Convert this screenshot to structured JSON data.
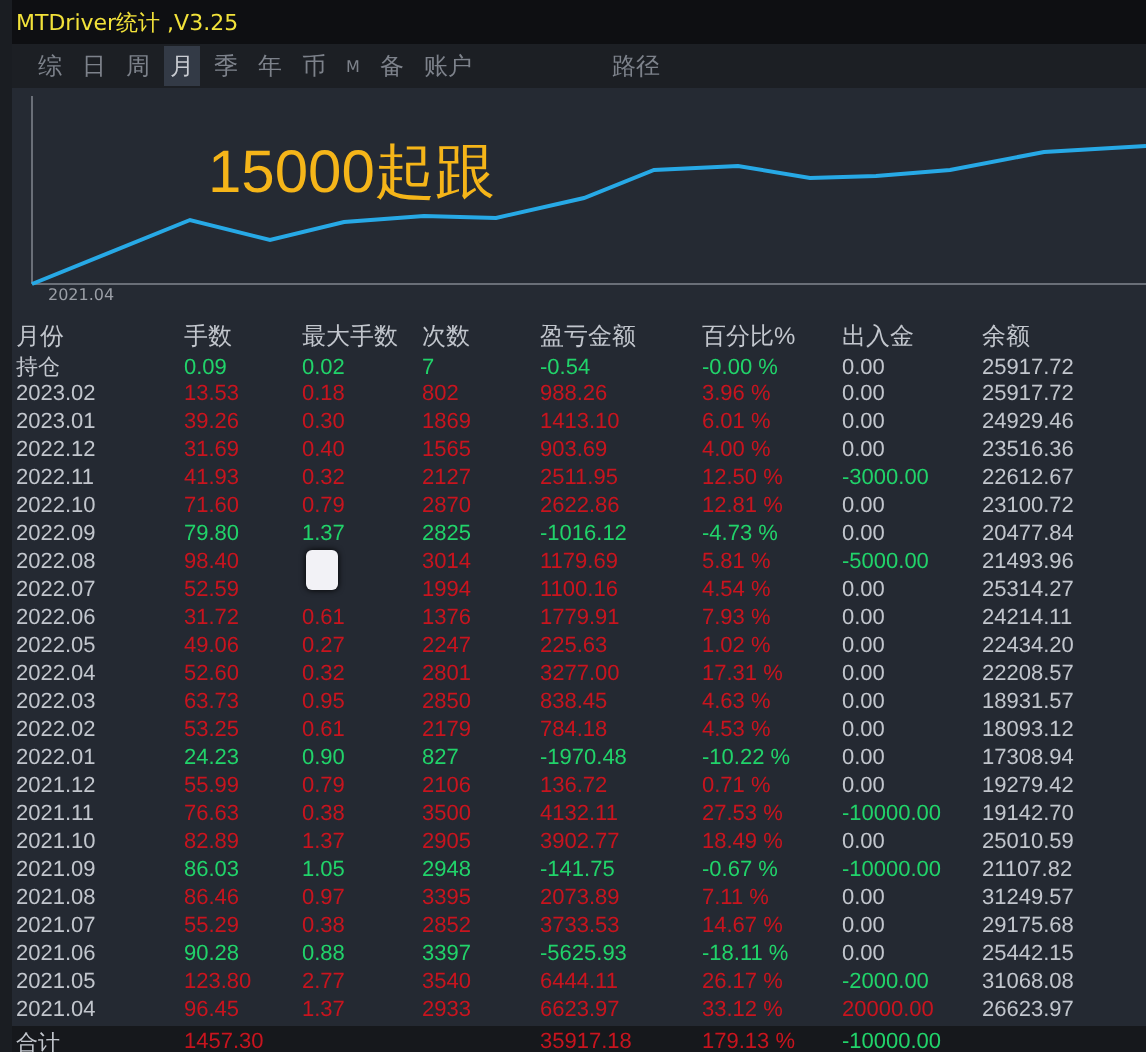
{
  "window": {
    "title": "MTDriver统计 ,V3.25"
  },
  "tabs": [
    {
      "label": "综",
      "selected": false,
      "kind": "tab"
    },
    {
      "label": "日",
      "selected": false,
      "kind": "tab"
    },
    {
      "label": "周",
      "selected": false,
      "kind": "tab"
    },
    {
      "label": "月",
      "selected": true,
      "kind": "tab"
    },
    {
      "label": "季",
      "selected": false,
      "kind": "tab"
    },
    {
      "label": "年",
      "selected": false,
      "kind": "tab"
    },
    {
      "label": "币",
      "selected": false,
      "kind": "tab"
    },
    {
      "label": "M",
      "selected": false,
      "kind": "small"
    },
    {
      "label": "备",
      "selected": false,
      "kind": "tab"
    },
    {
      "label": "账户",
      "selected": false,
      "kind": "tab"
    },
    {
      "label": "路径",
      "selected": false,
      "kind": "far"
    }
  ],
  "chart": {
    "annotation": "15000起跟",
    "x_label": "2021.04"
  },
  "table": {
    "columns": [
      "月份",
      "手数",
      "最大手数",
      "次数",
      "盈亏金额",
      "百分比%",
      "出入金",
      "余额"
    ],
    "rows": [
      {
        "month": "持仓",
        "lots": "0.09",
        "max_lots": "0.02",
        "trades": "7",
        "pnl": "-0.54",
        "pct": "-0.00 %",
        "flow": {
          "text": "0.00",
          "color": "#c2c6cd"
        },
        "balance": "25917.72",
        "color": "#21d36a"
      },
      {
        "month": "2023.02",
        "lots": "13.53",
        "max_lots": "0.18",
        "trades": "802",
        "pnl": "988.26",
        "pct": "3.96 %",
        "flow": {
          "text": "0.00",
          "color": "#c2c6cd"
        },
        "balance": "25917.72",
        "color": "#c8141e"
      },
      {
        "month": "2023.01",
        "lots": "39.26",
        "max_lots": "0.30",
        "trades": "1869",
        "pnl": "1413.10",
        "pct": "6.01 %",
        "flow": {
          "text": "0.00",
          "color": "#c2c6cd"
        },
        "balance": "24929.46",
        "color": "#c8141e"
      },
      {
        "month": "2022.12",
        "lots": "31.69",
        "max_lots": "0.40",
        "trades": "1565",
        "pnl": "903.69",
        "pct": "4.00 %",
        "flow": {
          "text": "0.00",
          "color": "#c2c6cd"
        },
        "balance": "23516.36",
        "color": "#c8141e"
      },
      {
        "month": "2022.11",
        "lots": "41.93",
        "max_lots": "0.32",
        "trades": "2127",
        "pnl": "2511.95",
        "pct": "12.50 %",
        "flow": {
          "text": "-3000.00",
          "color": "#21d36a"
        },
        "balance": "22612.67",
        "color": "#c8141e"
      },
      {
        "month": "2022.10",
        "lots": "71.60",
        "max_lots": "0.79",
        "trades": "2870",
        "pnl": "2622.86",
        "pct": "12.81 %",
        "flow": {
          "text": "0.00",
          "color": "#c2c6cd"
        },
        "balance": "23100.72",
        "color": "#c8141e"
      },
      {
        "month": "2022.09",
        "lots": "79.80",
        "max_lots": "1.37",
        "trades": "2825",
        "pnl": "-1016.12",
        "pct": "-4.73 %",
        "flow": {
          "text": "0.00",
          "color": "#c2c6cd"
        },
        "balance": "20477.84",
        "color": "#21d36a"
      },
      {
        "month": "2022.08",
        "lots": "98.40",
        "trades": "3014",
        "pnl": "1179.69",
        "pct": "5.81 %",
        "flow": {
          "text": "-5000.00",
          "color": "#21d36a"
        },
        "balance": "21493.96",
        "color": "#c8141e"
      },
      {
        "month": "2022.07",
        "lots": "52.59",
        "trades": "1994",
        "pnl": "1100.16",
        "pct": "4.54 %",
        "flow": {
          "text": "0.00",
          "color": "#c2c6cd"
        },
        "balance": "25314.27",
        "color": "#c8141e"
      },
      {
        "month": "2022.06",
        "lots": "31.72",
        "max_lots": "0.61",
        "trades": "1376",
        "pnl": "1779.91",
        "pct": "7.93 %",
        "flow": {
          "text": "0.00",
          "color": "#c2c6cd"
        },
        "balance": "24214.11",
        "color": "#c8141e"
      },
      {
        "month": "2022.05",
        "lots": "49.06",
        "max_lots": "0.27",
        "trades": "2247",
        "pnl": "225.63",
        "pct": "1.02 %",
        "flow": {
          "text": "0.00",
          "color": "#c2c6cd"
        },
        "balance": "22434.20",
        "color": "#c8141e"
      },
      {
        "month": "2022.04",
        "lots": "52.60",
        "max_lots": "0.32",
        "trades": "2801",
        "pnl": "3277.00",
        "pct": "17.31 %",
        "flow": {
          "text": "0.00",
          "color": "#c2c6cd"
        },
        "balance": "22208.57",
        "color": "#c8141e"
      },
      {
        "month": "2022.03",
        "lots": "63.73",
        "max_lots": "0.95",
        "trades": "2850",
        "pnl": "838.45",
        "pct": "4.63 %",
        "flow": {
          "text": "0.00",
          "color": "#c2c6cd"
        },
        "balance": "18931.57",
        "color": "#c8141e"
      },
      {
        "month": "2022.02",
        "lots": "53.25",
        "max_lots": "0.61",
        "trades": "2179",
        "pnl": "784.18",
        "pct": "4.53 %",
        "flow": {
          "text": "0.00",
          "color": "#c2c6cd"
        },
        "balance": "18093.12",
        "color": "#c8141e"
      },
      {
        "month": "2022.01",
        "lots": "24.23",
        "max_lots": "0.90",
        "trades": "827",
        "pnl": "-1970.48",
        "pct": "-10.22 %",
        "flow": {
          "text": "0.00",
          "color": "#c2c6cd"
        },
        "balance": "17308.94",
        "color": "#21d36a"
      },
      {
        "month": "2021.12",
        "lots": "55.99",
        "max_lots": "0.79",
        "trades": "2106",
        "pnl": "136.72",
        "pct": "0.71 %",
        "flow": {
          "text": "0.00",
          "color": "#c2c6cd"
        },
        "balance": "19279.42",
        "color": "#c8141e"
      },
      {
        "month": "2021.11",
        "lots": "76.63",
        "max_lots": "0.38",
        "trades": "3500",
        "pnl": "4132.11",
        "pct": "27.53 %",
        "flow": {
          "text": "-10000.00",
          "color": "#21d36a"
        },
        "balance": "19142.70",
        "color": "#c8141e"
      },
      {
        "month": "2021.10",
        "lots": "82.89",
        "max_lots": "1.37",
        "trades": "2905",
        "pnl": "3902.77",
        "pct": "18.49 %",
        "flow": {
          "text": "0.00",
          "color": "#c2c6cd"
        },
        "balance": "25010.59",
        "color": "#c8141e"
      },
      {
        "month": "2021.09",
        "lots": "86.03",
        "max_lots": "1.05",
        "trades": "2948",
        "pnl": "-141.75",
        "pct": "-0.67 %",
        "flow": {
          "text": "-10000.00",
          "color": "#21d36a"
        },
        "balance": "21107.82",
        "color": "#21d36a"
      },
      {
        "month": "2021.08",
        "lots": "86.46",
        "max_lots": "0.97",
        "trades": "3395",
        "pnl": "2073.89",
        "pct": "7.11 %",
        "flow": {
          "text": "0.00",
          "color": "#c2c6cd"
        },
        "balance": "31249.57",
        "color": "#c8141e"
      },
      {
        "month": "2021.07",
        "lots": "55.29",
        "max_lots": "0.38",
        "trades": "2852",
        "pnl": "3733.53",
        "pct": "14.67 %",
        "flow": {
          "text": "0.00",
          "color": "#c2c6cd"
        },
        "balance": "29175.68",
        "color": "#c8141e"
      },
      {
        "month": "2021.06",
        "lots": "90.28",
        "max_lots": "0.88",
        "trades": "3397",
        "pnl": "-5625.93",
        "pct": "-18.11 %",
        "flow": {
          "text": "0.00",
          "color": "#c2c6cd"
        },
        "balance": "25442.15",
        "color": "#21d36a"
      },
      {
        "month": "2021.05",
        "lots": "123.80",
        "max_lots": "2.77",
        "trades": "3540",
        "pnl": "6444.11",
        "pct": "26.17 %",
        "flow": {
          "text": "-2000.00",
          "color": "#21d36a"
        },
        "balance": "31068.08",
        "color": "#c8141e"
      },
      {
        "month": "2021.04",
        "lots": "96.45",
        "max_lots": "1.37",
        "trades": "2933",
        "pnl": "6623.97",
        "pct": "33.12 %",
        "flow": {
          "text": "20000.00",
          "color": "#c8141e"
        },
        "balance": "26623.97",
        "color": "#c8141e"
      }
    ],
    "total": {
      "label": "合计",
      "lots": "1457.30",
      "pnl": "35917.18",
      "pct": "179.13 %",
      "flow": {
        "text": "-10000.00",
        "color": "#21d36a"
      },
      "color": "#c8141e"
    }
  }
}
